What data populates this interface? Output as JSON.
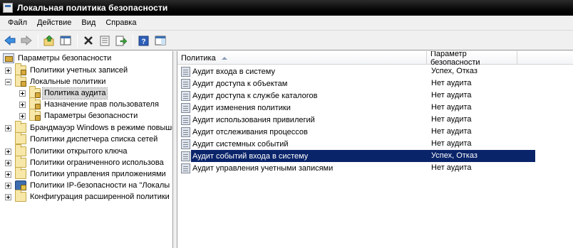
{
  "window": {
    "title": "Локальная политика безопасности"
  },
  "menu": [
    "Файл",
    "Действие",
    "Вид",
    "Справка"
  ],
  "toolbar": {
    "buttons": [
      "back-icon",
      "forward-icon",
      "up-folder-icon",
      "show-hide-tree-icon",
      "delete-icon",
      "properties-icon",
      "export-icon",
      "help-icon",
      "action-pane-icon"
    ]
  },
  "tree": {
    "root": "Параметры безопасности",
    "items": [
      {
        "label": "Политики учетных записей",
        "indent": 1,
        "expander": "plus",
        "icon": "folder-lock"
      },
      {
        "label": "Локальные политики",
        "indent": 1,
        "expander": "minus",
        "icon": "folder-lock"
      },
      {
        "label": "Политика аудита",
        "indent": 2,
        "expander": "plus",
        "icon": "folder-lock",
        "selected": true
      },
      {
        "label": "Назначение прав пользователя",
        "indent": 2,
        "expander": "plus",
        "icon": "folder-lock"
      },
      {
        "label": "Параметры безопасности",
        "indent": 2,
        "expander": "plus",
        "icon": "folder-lock"
      },
      {
        "label": "Брандмауэр Windows в режиме повыше",
        "indent": 1,
        "expander": "plus",
        "icon": "folder"
      },
      {
        "label": "Политики диспетчера списка сетей",
        "indent": 1,
        "expander": "none",
        "icon": "folder"
      },
      {
        "label": "Политики открытого ключа",
        "indent": 1,
        "expander": "plus",
        "icon": "folder"
      },
      {
        "label": "Политики ограниченного использова",
        "indent": 1,
        "expander": "plus",
        "icon": "folder"
      },
      {
        "label": "Политики управления приложениями",
        "indent": 1,
        "expander": "plus",
        "icon": "folder"
      },
      {
        "label": "Политики IP-безопасности на \"Локалы",
        "indent": 1,
        "expander": "plus",
        "icon": "ipsec"
      },
      {
        "label": "Конфигурация расширенной политики",
        "indent": 1,
        "expander": "plus",
        "icon": "folder"
      }
    ]
  },
  "list": {
    "columns": [
      "Политика",
      "Параметр безопасности"
    ],
    "sort_column": "Политика",
    "rows": [
      {
        "policy": "Аудит входа в систему",
        "setting": "Успех, Отказ"
      },
      {
        "policy": "Аудит доступа к объектам",
        "setting": "Нет аудита"
      },
      {
        "policy": "Аудит доступа к службе каталогов",
        "setting": "Нет аудита"
      },
      {
        "policy": "Аудит изменения политики",
        "setting": "Нет аудита"
      },
      {
        "policy": "Аудит использования привилегий",
        "setting": "Нет аудита"
      },
      {
        "policy": "Аудит отслеживания процессов",
        "setting": "Нет аудита"
      },
      {
        "policy": "Аудит системных событий",
        "setting": "Нет аудита"
      },
      {
        "policy": "Аудит событий входа в систему",
        "setting": "Успех, Отказ",
        "selected": true
      },
      {
        "policy": "Аудит управления учетными записями",
        "setting": "Нет аудита"
      }
    ]
  },
  "colors": {
    "titlebar": "#000000",
    "selection": "#0a246a",
    "tree_selection": "#d9d9d9"
  }
}
